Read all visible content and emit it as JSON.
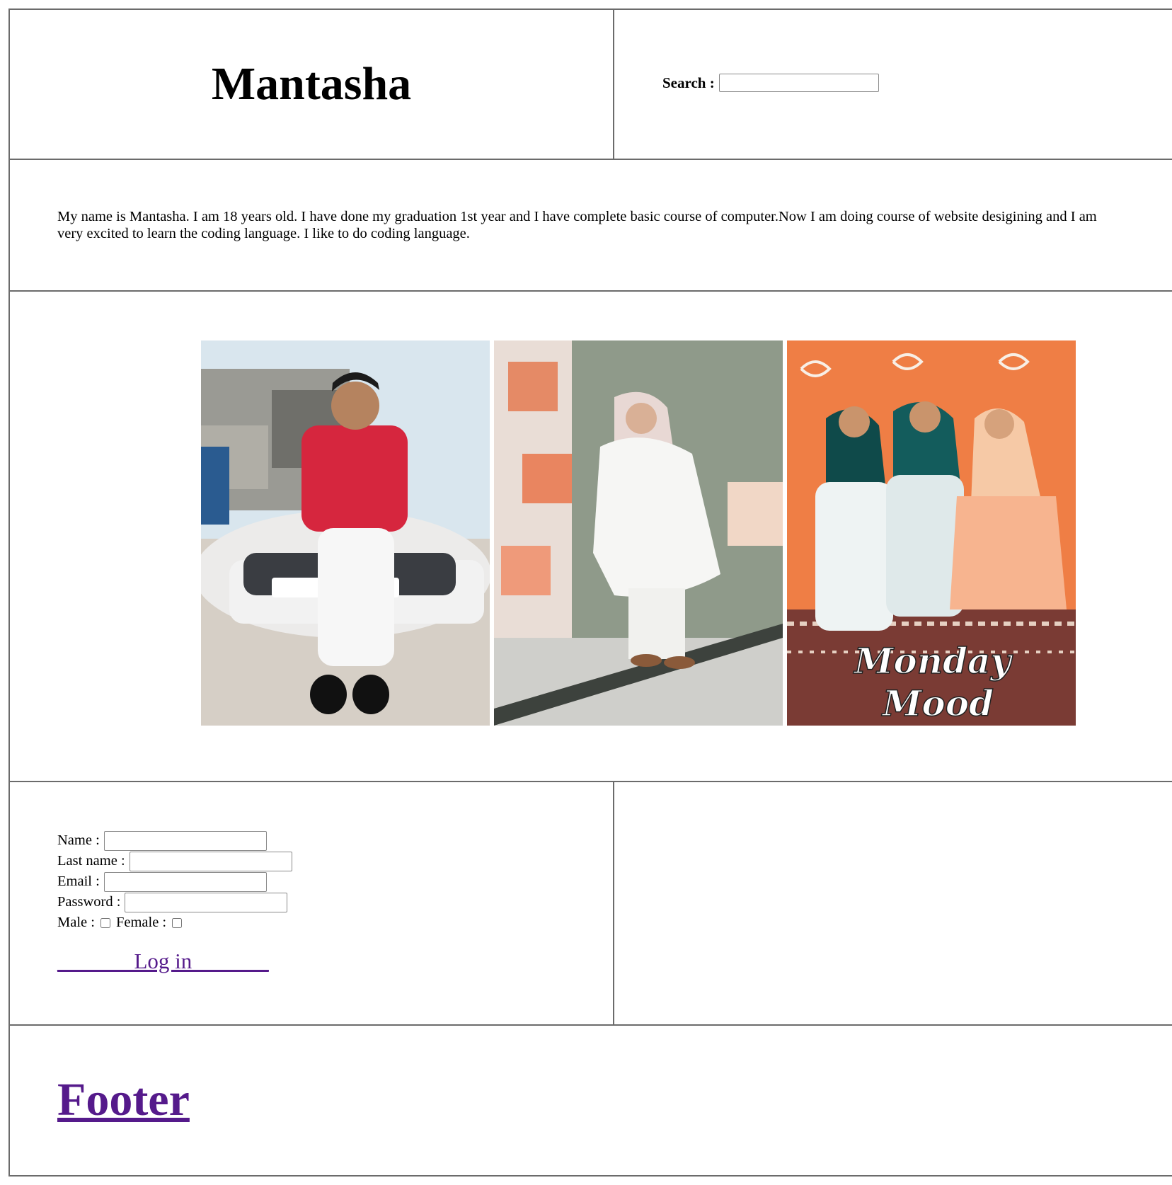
{
  "header": {
    "title": "Mantasha",
    "search_label": "Search :",
    "search_value": ""
  },
  "intro": {
    "text": "My name is Mantasha. I am 18 years old. I have done my graduation 1st year and I have complete basic course of computer.Now I am doing course of website desigining and I am very excited to learn the coding language. I like to do coding language."
  },
  "gallery": {
    "photos": [
      {
        "icon": "photo-man-red-shirt-by-car"
      },
      {
        "icon": "photo-woman-white-dress"
      },
      {
        "icon": "photo-three-women-orange-wall",
        "overlay_text": "Monday Mood"
      }
    ]
  },
  "form": {
    "name_label": "Name :",
    "last_name_label": "Last name :",
    "email_label": "Email :",
    "password_label": "Password :",
    "male_label": "Male :",
    "female_label": "Female :",
    "login_link": "_______Log in_______"
  },
  "footer": {
    "text": "Footer"
  },
  "colors": {
    "link_visited": "#551a8b",
    "border": "#6b6b6b"
  }
}
